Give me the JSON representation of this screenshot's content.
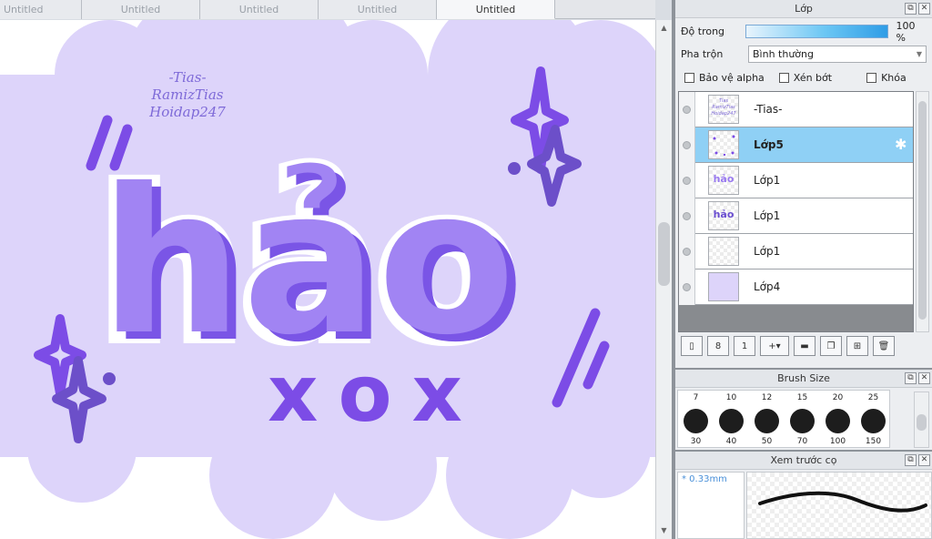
{
  "tabs": [
    "Untitled",
    "Untitled",
    "Untitled",
    "Untitled",
    "Untitled"
  ],
  "active_tab": 4,
  "artwork": {
    "signature_lines": [
      "-Tias-",
      "RamizTias",
      "Hoidap247"
    ],
    "main_word": "hảo",
    "sub_word": "xox",
    "colors": {
      "cloud": "#ddd4fa",
      "letter": "#a184f3",
      "letter_shadow": "#7a55e6",
      "accent": "#7c4ce6",
      "sparkle_dark": "#6c4fc9"
    }
  },
  "layer_panel": {
    "title": "Lớp",
    "opacity_label": "Độ trong",
    "opacity_value": "100 %",
    "opacity_fraction": 1.0,
    "blend_label": "Pha trộn",
    "blend_value": "Bình thường",
    "checkboxes": [
      {
        "label": "Bảo vệ alpha",
        "checked": false
      },
      {
        "label": "Xén bớt",
        "checked": false
      },
      {
        "label": "Khóa",
        "checked": false
      }
    ],
    "layers": [
      {
        "name": "-Tias-",
        "selected": false,
        "thumb_text": "Tias RamizTias Hoidap247"
      },
      {
        "name": "Lớp5",
        "selected": true,
        "thumb_text": ""
      },
      {
        "name": "Lớp1",
        "selected": false,
        "thumb_text": "hảo"
      },
      {
        "name": "Lớp1",
        "selected": false,
        "thumb_text": "hảo"
      },
      {
        "name": "Lớp1",
        "selected": false,
        "thumb_text": ""
      },
      {
        "name": "Lớp4",
        "selected": false,
        "thumb_text": ""
      }
    ],
    "tool_icons": [
      "new-layer-icon",
      "new-8bit-layer-icon",
      "new-1bit-layer-icon",
      "add-layer-menu-icon",
      "folder-icon",
      "copy-layer-icon",
      "merge-layer-icon",
      "delete-layer-icon"
    ]
  },
  "brush_size_panel": {
    "title": "Brush Size",
    "top_sizes": [
      "7",
      "10",
      "12",
      "15",
      "20",
      "25"
    ],
    "bottom_sizes": [
      "30",
      "40",
      "50",
      "70",
      "100",
      "150"
    ]
  },
  "brush_preview_panel": {
    "title": "Xem trước cọ",
    "size_text": "* 0.33mm"
  },
  "panel_buttons": {
    "float": "⧉",
    "close": "✕"
  }
}
